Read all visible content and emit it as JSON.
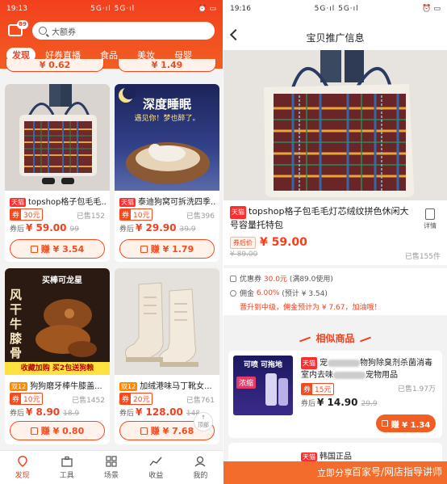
{
  "left": {
    "status": {
      "time": "19:13",
      "signal": "5G·ıl 5G·ıl",
      "right": "⏰ ▭"
    },
    "message_badge": "89",
    "search_placeholder": "大额券",
    "categories": [
      "发现",
      "好券直播",
      "食品",
      "美妆",
      "母婴"
    ],
    "top_partial_price": {
      "left": "¥ 0.62",
      "right": "¥ 1.49"
    },
    "products": [
      {
        "brand": "天猫",
        "title": "topshop格子包毛毛...",
        "coupon": "30元",
        "sold": "已售152",
        "after_label": "券后",
        "price": "¥ 59.00",
        "old_price": "99",
        "earn": "赚 ¥ 3.54"
      },
      {
        "brand": "天猫",
        "title": "泰迪狗窝可拆洗四季...",
        "coupon": "10元",
        "sold": "已售396",
        "after_label": "券后",
        "price": "¥ 29.90",
        "old_price": "39.9",
        "earn": "赚 ¥ 1.79",
        "img_text": "深度睡眠",
        "img_sub": "遇见你！梦也醉了。"
      },
      {
        "brand": "双12",
        "title": "狗狗磨牙棒牛膝盖...",
        "coupon": "10元",
        "sold": "已售1452",
        "after_label": "券后",
        "price": "¥ 8.90",
        "old_price": "18.9",
        "earn": "赚 ¥ 0.80",
        "img_text": "风干牛膝骨",
        "img_top": "买棒可龙星",
        "img_bottom": "收藏加购 买2包送狗粮"
      },
      {
        "brand": "双12",
        "title": "加绒港味马丁靴女...",
        "coupon": "20元",
        "sold": "已售761",
        "after_label": "券后",
        "price": "¥ 128.00",
        "old_price": "148",
        "earn": "赚 ¥ 7.68"
      }
    ],
    "top_button": "顶部",
    "tabs": [
      "发现",
      "工具",
      "场景",
      "收益",
      "我的"
    ]
  },
  "right": {
    "status": {
      "time": "19:16",
      "signal": "5G·ıl 5G·ıl",
      "right": "⏰ ▭"
    },
    "title": "宝贝推广信息",
    "product": {
      "brand": "天猫",
      "title": "topshop格子包毛毛灯芯绒纹拼色休闲大号容量托特包",
      "detail_label": "详情",
      "price_tag": "券后价",
      "price": "¥ 59.00",
      "old_price": "¥ 89.00",
      "sold": "已售155件"
    },
    "commission": {
      "coupon_label": "优惠券",
      "coupon_value": "30.0元",
      "coupon_note": "(满89.0使用)",
      "rate_label": "佣金",
      "rate_value": "6.00%",
      "rate_note": "(预计 ¥ 3.54)",
      "hint": "晋升到中级，佣金预计为 ¥ 7.67，加油哦！"
    },
    "similar_title": "相似商品",
    "similar": [
      {
        "brand": "天猫",
        "title_a": "宠",
        "title_b": "物狗除臭剂杀菌消毒室内去味",
        "title_c": "宠物用品",
        "coupon": "15元",
        "sold": "已售1.97万",
        "after_label": "券后",
        "price": "¥ 14.90",
        "old_price": "29.9",
        "earn": "赚 ¥ 1.34",
        "thumb_top": "可喷 可拖地",
        "thumb_mid": "浓缩"
      },
      {
        "brand": "天猫",
        "title": "韩国正品"
      }
    ],
    "share_label": "立即分享",
    "watermark": "百家号/网店指导讲师"
  }
}
